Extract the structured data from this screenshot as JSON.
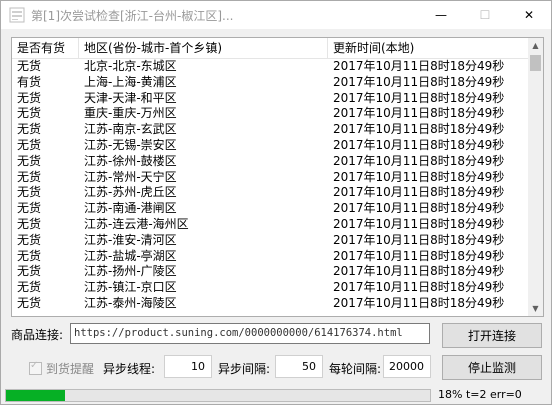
{
  "window": {
    "title": "第[1]次尝试检查[浙江-台州-椒江区]...",
    "minimize_glyph": "—",
    "maximize_glyph": "☐",
    "close_glyph": "✕"
  },
  "table": {
    "columns": [
      "是否有货",
      "地区(省份-城市-首个乡镇)",
      "更新时间(本地)"
    ],
    "rows": [
      [
        "无货",
        "北京-北京-东城区",
        "2017年10月11日8时18分49秒"
      ],
      [
        "有货",
        "上海-上海-黄浦区",
        "2017年10月11日8时18分49秒"
      ],
      [
        "无货",
        "天津-天津-和平区",
        "2017年10月11日8时18分49秒"
      ],
      [
        "无货",
        "重庆-重庆-万州区",
        "2017年10月11日8时18分49秒"
      ],
      [
        "无货",
        "江苏-南京-玄武区",
        "2017年10月11日8时18分49秒"
      ],
      [
        "无货",
        "江苏-无锡-崇安区",
        "2017年10月11日8时18分49秒"
      ],
      [
        "无货",
        "江苏-徐州-鼓楼区",
        "2017年10月11日8时18分49秒"
      ],
      [
        "无货",
        "江苏-常州-天宁区",
        "2017年10月11日8时18分49秒"
      ],
      [
        "无货",
        "江苏-苏州-虎丘区",
        "2017年10月11日8时18分49秒"
      ],
      [
        "无货",
        "江苏-南通-港闸区",
        "2017年10月11日8时18分49秒"
      ],
      [
        "无货",
        "江苏-连云港-海州区",
        "2017年10月11日8时18分49秒"
      ],
      [
        "无货",
        "江苏-淮安-清河区",
        "2017年10月11日8时18分49秒"
      ],
      [
        "无货",
        "江苏-盐城-亭湖区",
        "2017年10月11日8时18分49秒"
      ],
      [
        "无货",
        "江苏-扬州-广陵区",
        "2017年10月11日8时18分49秒"
      ],
      [
        "无货",
        "江苏-镇江-京口区",
        "2017年10月11日8时18分49秒"
      ],
      [
        "无货",
        "江苏-泰州-海陵区",
        "2017年10月11日8时18分49秒"
      ]
    ]
  },
  "form": {
    "product_link_label": "商品连接:",
    "product_link_value": "https://product.suning.com/0000000000/614176374.html",
    "connect_button": "打开连接",
    "stock_alert_label": "到货提醒",
    "async_threads_label": "异步线程:",
    "async_threads_value": "10",
    "async_interval_label": "异步间隔:",
    "async_interval_value": "50",
    "round_interval_label": "每轮间隔:",
    "round_interval_value": "20000",
    "stop_button": "停止监测"
  },
  "status": {
    "progress_percent": 14,
    "text": "18% t=2 err=0",
    "progress_color": "#06b025"
  }
}
